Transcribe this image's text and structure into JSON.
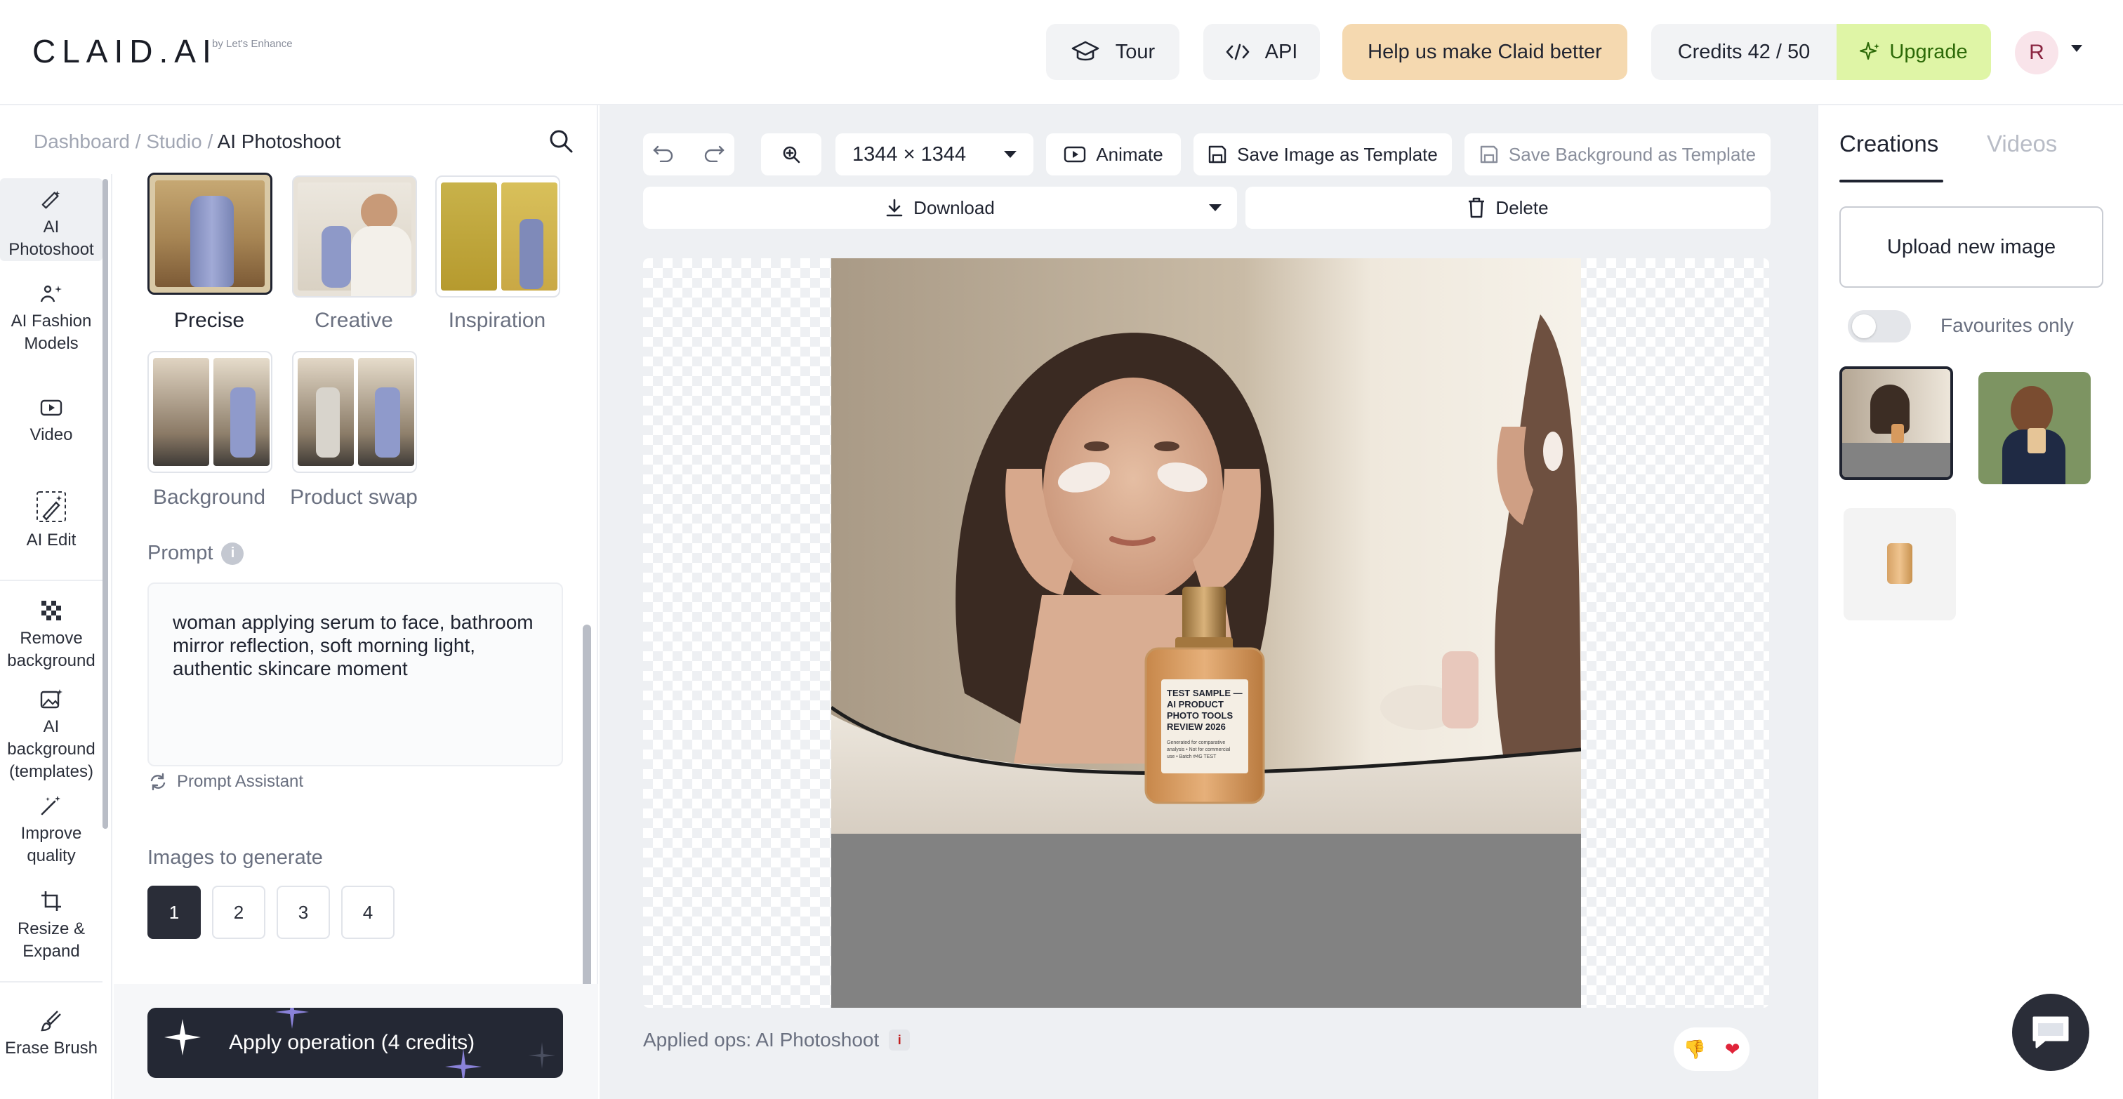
{
  "header": {
    "logo": "CLAID.AI",
    "logo_sub": "by Let's Enhance",
    "tour_label": "Tour",
    "api_label": "API",
    "help_label": "Help us make Claid better",
    "credits_label": "Credits 42 / 50",
    "upgrade_label": "Upgrade",
    "avatar_initial": "R",
    "colors": {
      "help_bg": "#f5d9b0",
      "upgrade_bg": "#dff5a6",
      "upgrade_text": "#2d6a08"
    }
  },
  "breadcrumb": {
    "dashboard": "Dashboard",
    "sep1": " / ",
    "studio": "Studio",
    "sep2": " / ",
    "current": "AI Photoshoot"
  },
  "rail": {
    "items": [
      {
        "label": "AI Photoshoot",
        "icon": "magic-pen-icon",
        "active": true
      },
      {
        "label": "AI Fashion Models",
        "icon": "sparkle-person-icon"
      },
      {
        "label": "Video",
        "icon": "video-play-icon"
      },
      {
        "label": "AI Edit",
        "icon": "wand-edit-icon"
      },
      {
        "label": "Remove background",
        "icon": "checkerboard-icon"
      },
      {
        "label": "AI background (templates)",
        "icon": "image-sparkle-icon"
      },
      {
        "label": "Improve quality",
        "icon": "magic-wand-icon"
      },
      {
        "label": "Resize & Expand",
        "icon": "crop-icon"
      },
      {
        "label": "Erase Brush",
        "icon": "brush-icon"
      }
    ]
  },
  "styles": {
    "items": [
      {
        "label": "Precise",
        "selected": true
      },
      {
        "label": "Creative"
      },
      {
        "label": "Inspiration"
      },
      {
        "label": "Background"
      },
      {
        "label": "Product swap"
      }
    ]
  },
  "prompt": {
    "label": "Prompt",
    "text": "woman applying serum to face, bathroom mirror reflection, soft morning light, authentic skincare moment",
    "assistant_label": "Prompt Assistant"
  },
  "generate": {
    "label": "Images to generate",
    "options": [
      "1",
      "2",
      "3",
      "4"
    ],
    "selected": "1"
  },
  "apply_label": "Apply operation (4 credits)",
  "toolbar": {
    "size_value": "1344 × 1344",
    "animate_label": "Animate",
    "save_image_template_label": "Save Image as Template",
    "save_bg_template_label": "Save Background as Template",
    "download_label": "Download",
    "delete_label": "Delete"
  },
  "canvas": {
    "bottle_label": "TEST SAMPLE — AI PRODUCT PHOTO TOOLS REVIEW 2026",
    "bottle_small": "Generated for comparative analysis • Not for commercial use • Batch #4G TEST"
  },
  "applied": {
    "label": "Applied ops: AI Photoshoot",
    "badge": "i"
  },
  "right": {
    "tab_creations": "Creations",
    "tab_videos": "Videos",
    "upload_label": "Upload new image",
    "favourites_label": "Favourites only"
  }
}
